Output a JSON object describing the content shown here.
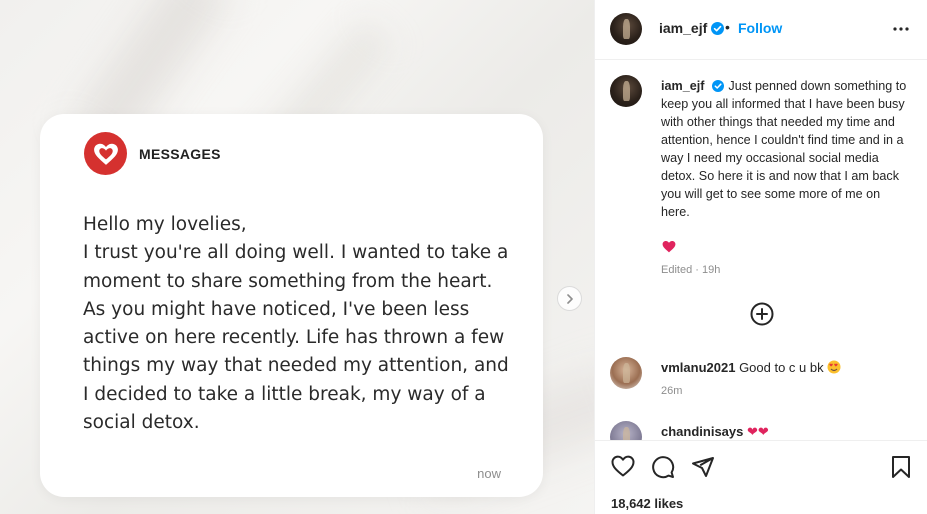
{
  "media": {
    "card_title": "MESSAGES",
    "card_body": "Hello my lovelies,\nI trust you're all doing well. I wanted to take a moment to share something from the heart. As you might have noticed, I've been less active on here recently. Life has thrown a few things my way that needed my attention, and I decided to take a little break, my way of a social detox.",
    "card_time": "now"
  },
  "header": {
    "username": "iam_ejf",
    "separator": "•",
    "follow_label": "Follow"
  },
  "caption": {
    "username": "iam_ejf",
    "text": "Just penned down something to keep you all informed that I have been busy with other things that needed my time and attention, hence I couldn't find time and in a way I need my occasional social media detox. So here it is and now that I am back you will get to see some more of me on here.",
    "emoji": "❤",
    "edited": "Edited · 19h"
  },
  "comments": [
    {
      "username": "vmlanu2021",
      "text": "Good to c u bk",
      "emoji": "😍",
      "time": "26m"
    },
    {
      "username": "chandinisays",
      "text": "",
      "emoji": "❤❤"
    }
  ],
  "actions": {
    "likes": "18,642 likes"
  },
  "colors": {
    "accent": "#0095f6",
    "heart": "#d5312f",
    "verified": "#0095f6"
  },
  "icons": [
    "heart-logo-icon",
    "verified-icon",
    "more-icon",
    "chevron-right-icon",
    "add-circle-icon",
    "like-icon",
    "comment-icon",
    "share-icon",
    "save-icon"
  ]
}
